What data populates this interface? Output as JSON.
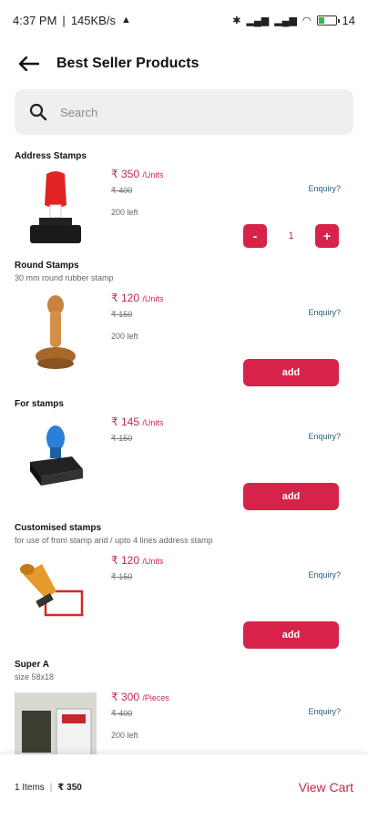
{
  "status_bar": {
    "time": "4:37 PM",
    "speed": "145KB/s",
    "battery_label": "14",
    "battery_level": 0.3
  },
  "header": {
    "title": "Best Seller Products",
    "back_icon": "arrow-left-icon"
  },
  "search": {
    "placeholder": "Search",
    "icon": "search-icon"
  },
  "products": [
    {
      "name": "Address Stamps",
      "description": "",
      "price": "₹ 350",
      "unit": "/Units",
      "mrp": "₹ 400",
      "stock": "200 left",
      "enquiry": "Enquiry?",
      "in_cart": true,
      "quantity": "1"
    },
    {
      "name": "Round Stamps",
      "description": "30 mm round rubber stamp",
      "price": "₹ 120",
      "unit": "/Units",
      "mrp": "₹ 150",
      "stock": "200 left",
      "enquiry": "Enquiry?",
      "in_cart": false,
      "add_label": "add"
    },
    {
      "name": "For stamps",
      "description": "",
      "price": "₹ 145",
      "unit": "/Units",
      "mrp": "₹ 150",
      "stock": "",
      "enquiry": "Enquiry?",
      "in_cart": false,
      "add_label": "add"
    },
    {
      "name": "Customised stamps",
      "description": "for use of from stamp and / upto 4 lines address stamp",
      "price": "₹ 120",
      "unit": "/Units",
      "mrp": "₹ 150",
      "stock": "",
      "enquiry": "Enquiry?",
      "in_cart": false,
      "add_label": "add"
    },
    {
      "name": "Super A",
      "description": "size 58x18",
      "price": "₹ 300",
      "unit": "/Pieces",
      "mrp": "₹ 400",
      "stock": "200 left",
      "enquiry": "Enquiry?",
      "in_cart": false
    }
  ],
  "stepper": {
    "minus": "-",
    "plus": "+"
  },
  "cart": {
    "items": "1 Items",
    "separator": "|",
    "total": "₹ 350",
    "view_label": "View Cart"
  },
  "colors": {
    "accent": "#d7234a",
    "price": "#c7274a",
    "link": "#2a5e7a"
  }
}
